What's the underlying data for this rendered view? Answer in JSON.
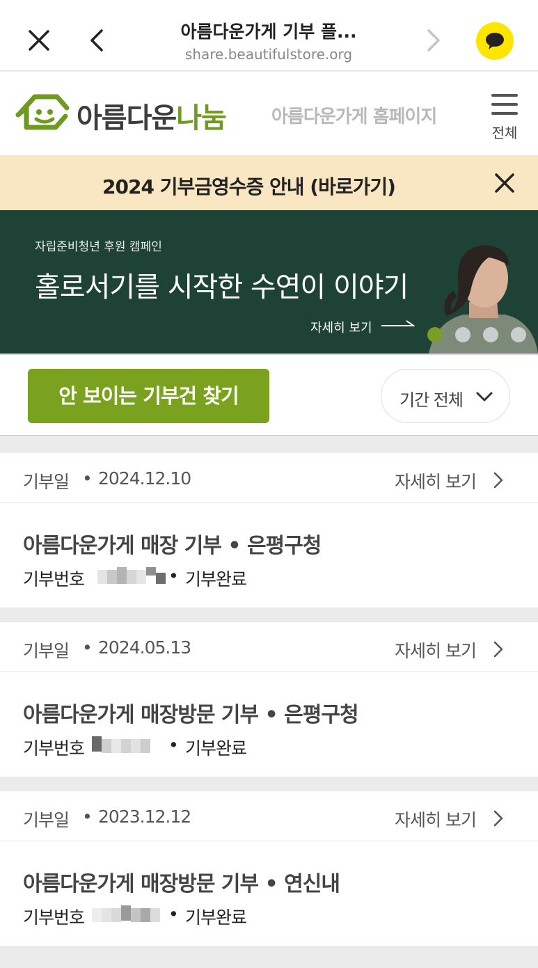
{
  "browser": {
    "title": "아름다운가게 기부 플...",
    "url": "share.beautifulstore.org"
  },
  "header": {
    "logo_text_a": "아름다운",
    "logo_text_b": "나눔",
    "home_link": "아름다운가게 홈페이지",
    "menu_label": "전체"
  },
  "notice": {
    "text": "2024 기부금영수증 안내 (바로가기)"
  },
  "campaign": {
    "subtitle": "자립준비청년 후원 캠페인",
    "title": "홀로서기를 시작한 수연이 이야기",
    "more": "자세히 보기",
    "slide_count": 4,
    "active_slide": 1
  },
  "filter": {
    "find_button": "안 보이는 기부건 찾기",
    "period": "기간 전체"
  },
  "donations": [
    {
      "date_label": "기부일",
      "separator": "•",
      "date": "2024.12.10",
      "detail": "자세히 보기",
      "title": "아름다운가게 매장 기부  •  은평구청",
      "number_label": "기부번호",
      "status": "기부완료"
    },
    {
      "date_label": "기부일",
      "separator": "•",
      "date": "2024.05.13",
      "detail": "자세히 보기",
      "title": "아름다운가게 매장방문 기부  •  은평구청",
      "number_label": "기부번호",
      "status": "기부완료"
    },
    {
      "date_label": "기부일",
      "separator": "•",
      "date": "2023.12.12",
      "detail": "자세히 보기",
      "title": "아름다운가게 매장방문 기부  •  연신내",
      "number_label": "기부번호",
      "status": "기부완료"
    }
  ],
  "colors": {
    "brand_green": "#7aa21f",
    "notice_bg": "#f8e7c2",
    "campaign_bg": "#1f4236",
    "kakao_yellow": "#fee500"
  }
}
